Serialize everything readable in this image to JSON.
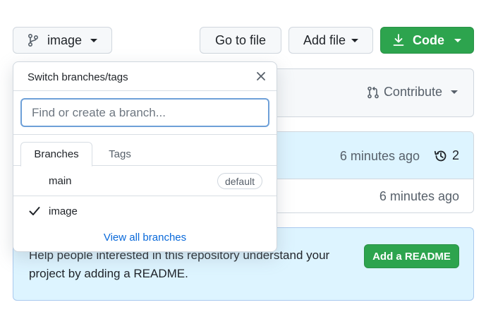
{
  "toolbar": {
    "branch_label": "image",
    "goto_label": "Go to file",
    "addfile_label": "Add file",
    "code_label": "Code"
  },
  "contribute": {
    "label": "Contribute"
  },
  "commits": {
    "latest_time": "6 minutes ago",
    "history_count": "2",
    "file_time": "6 minutes ago"
  },
  "readme": {
    "text": "Help people interested in this repository understand your project by adding a README.",
    "button_label": "Add a README"
  },
  "dropdown": {
    "title": "Switch branches/tags",
    "input_placeholder": "Find or create a branch...",
    "tabs": [
      "Branches",
      "Tags"
    ],
    "branches": [
      {
        "name": "main",
        "badge": "default",
        "checked": false
      },
      {
        "name": "image",
        "badge": "",
        "checked": true
      }
    ],
    "view_all": "View all branches"
  },
  "colors": {
    "primary_green": "#2da44e",
    "link_blue": "#0969da",
    "info_bg": "#ddf4ff",
    "border": "#d0d7de"
  },
  "icons": [
    "branch-icon",
    "download-icon",
    "pull-request-icon",
    "history-icon",
    "close-icon",
    "check-icon"
  ]
}
